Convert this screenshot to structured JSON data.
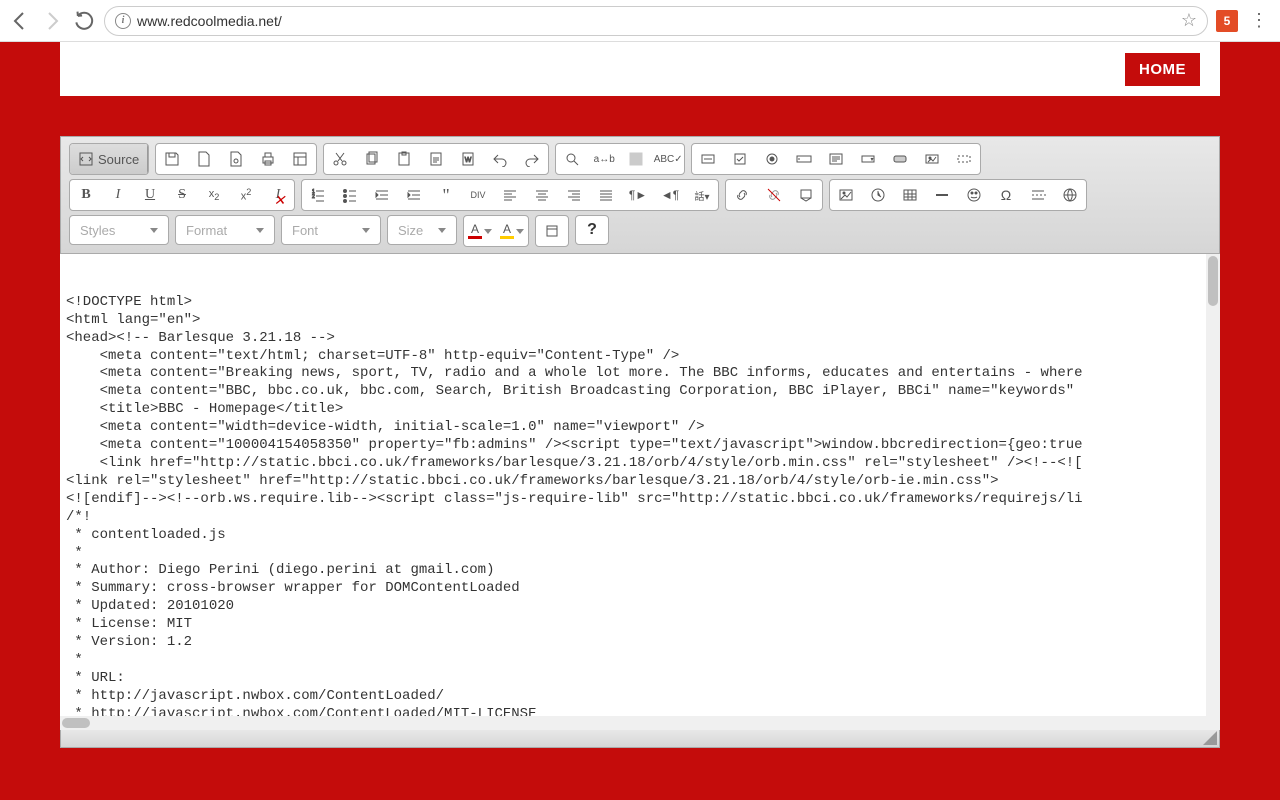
{
  "browser": {
    "url": "www.redcoolmedia.net/",
    "extension_badge": "5"
  },
  "header": {
    "home_label": "HOME"
  },
  "toolbar": {
    "source_label": "Source",
    "styles_label": "Styles",
    "format_label": "Format",
    "font_label": "Font",
    "size_label": "Size",
    "help_label": "?"
  },
  "code_lines": [
    "<!DOCTYPE html>",
    "<html lang=\"en\">",
    "<head><!-- Barlesque 3.21.18 -->",
    "    <meta content=\"text/html; charset=UTF-8\" http-equiv=\"Content-Type\" />",
    "    <meta content=\"Breaking news, sport, TV, radio and a whole lot more. The BBC informs, educates and entertains - where",
    "    <meta content=\"BBC, bbc.co.uk, bbc.com, Search, British Broadcasting Corporation, BBC iPlayer, BBCi\" name=\"keywords\"",
    "    <title>BBC - Homepage</title>",
    "    <meta content=\"width=device-width, initial-scale=1.0\" name=\"viewport\" />",
    "    <meta content=\"100004154058350\" property=\"fb:admins\" /><script type=\"text/javascript\">window.bbcredirection={geo:true",
    "    <link href=\"http://static.bbci.co.uk/frameworks/barlesque/3.21.18/orb/4/style/orb.min.css\" rel=\"stylesheet\" /><!--<![",
    "<link rel=\"stylesheet\" href=\"http://static.bbci.co.uk/frameworks/barlesque/3.21.18/orb/4/style/orb-ie.min.css\">",
    "<![endif]--><!--orb.ws.require.lib--><script class=\"js-require-lib\" src=\"http://static.bbci.co.uk/frameworks/requirejs/li",
    "/*!",
    " * contentloaded.js",
    " *",
    " * Author: Diego Perini (diego.perini at gmail.com)",
    " * Summary: cross-browser wrapper for DOMContentLoaded",
    " * Updated: 20101020",
    " * License: MIT",
    " * Version: 1.2",
    " *",
    " * URL:",
    " * http://javascript.nwbox.com/ContentLoaded/",
    " * http://javascript.nwbox.com/ContentLoaded/MIT-LICENSE",
    " *",
    " */"
  ]
}
